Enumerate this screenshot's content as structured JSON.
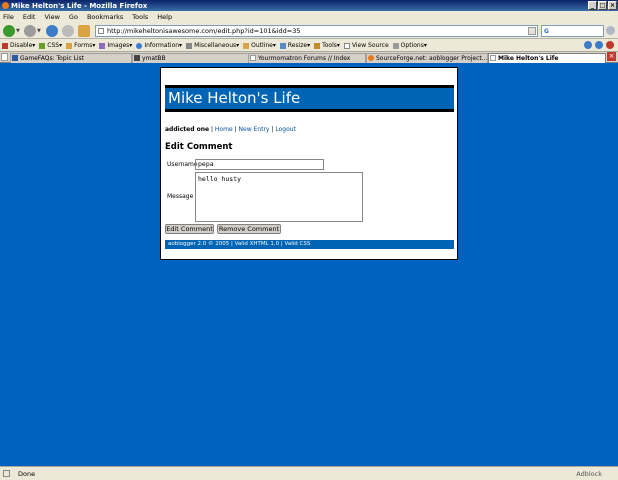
{
  "window": {
    "title": "Mike Helton's Life - Mozilla Firefox"
  },
  "menu": [
    "File",
    "Edit",
    "View",
    "Go",
    "Bookmarks",
    "Tools",
    "Help"
  ],
  "nav": {
    "url": "http://mikeheltonisawesome.com/edit.php?id=101&idd=35"
  },
  "devbar": {
    "items": [
      "Disable▾",
      "CSS▾",
      "Forms▾",
      "Images▾",
      "Information▾",
      "Miscellaneous▾",
      "Outline▾",
      "Resize▾",
      "Tools▾",
      "View Source",
      "Options▾"
    ]
  },
  "tabs": [
    {
      "label": "GameFAQs: Topic List",
      "active": false
    },
    {
      "label": "ymatBB",
      "active": false
    },
    {
      "label": "Yourmomatron Forums // Index",
      "active": false
    },
    {
      "label": "SourceForge.net: aoblogger Project...",
      "active": false
    },
    {
      "label": "Mike Helton's Life",
      "active": true
    }
  ],
  "page": {
    "site_title": "Mike Helton's Life",
    "nav": {
      "user": "addicted one",
      "sep": "|",
      "home": "Home",
      "new_entry": "New Entry",
      "logout": "Logout"
    },
    "heading": "Edit Comment",
    "username_label": "Username",
    "username_value": "pepa",
    "message_label": "Message",
    "message_value": "hello husty",
    "edit_button": "Edit Comment",
    "remove_button": "Remove Comment",
    "footer": "aoblogger 2.0 © 2005 | Valid XHTML 1.0 | Valid CSS"
  },
  "status": {
    "text": "Done",
    "adblock": "Adblock"
  },
  "colors": {
    "page_bg": "#0062c0",
    "header_bg": "#0064b5"
  }
}
